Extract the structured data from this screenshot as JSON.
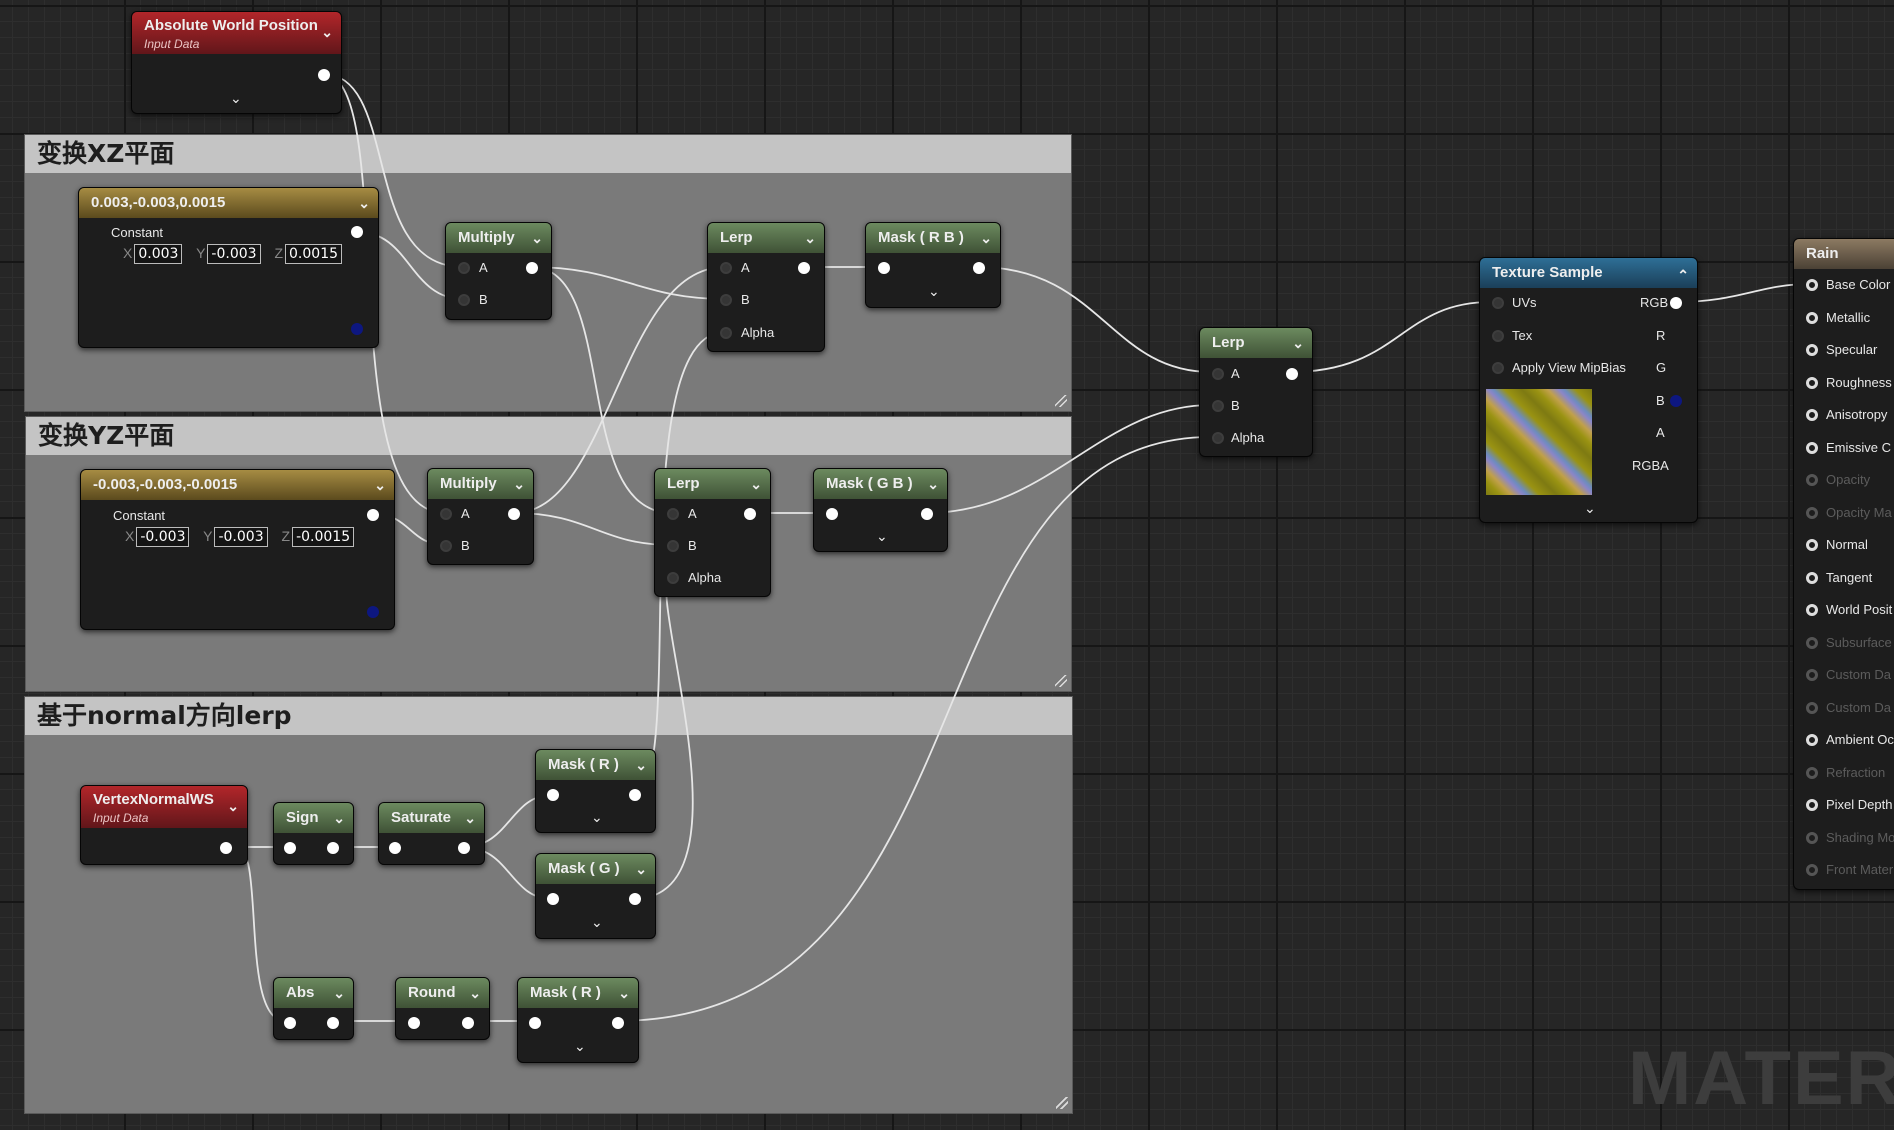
{
  "comments": {
    "xz": {
      "title": "变换XZ平面"
    },
    "yz": {
      "title": "变换YZ平面"
    },
    "normal": {
      "title": "基于normal方向lerp"
    }
  },
  "nodes": {
    "absolute_world_position": {
      "title": "Absolute World Position",
      "subtitle": "Input Data"
    },
    "const_xz": {
      "title": "0.003,-0.003,0.0015",
      "label": "Constant",
      "x_label": "X",
      "x": "0.003",
      "y_label": "Y",
      "y": "-0.003",
      "z_label": "Z",
      "z": "0.0015"
    },
    "multiply_xz": {
      "title": "Multiply",
      "a": "A",
      "b": "B"
    },
    "lerp_xz": {
      "title": "Lerp",
      "a": "A",
      "b": "B",
      "alpha": "Alpha"
    },
    "mask_rb": {
      "title": "Mask ( R B )"
    },
    "const_yz": {
      "title": "-0.003,-0.003,-0.0015",
      "label": "Constant",
      "x_label": "X",
      "x": "-0.003",
      "y_label": "Y",
      "y": "-0.003",
      "z_label": "Z",
      "z": "-0.0015"
    },
    "multiply_yz": {
      "title": "Multiply",
      "a": "A",
      "b": "B"
    },
    "lerp_yz": {
      "title": "Lerp",
      "a": "A",
      "b": "B",
      "alpha": "Alpha"
    },
    "mask_gb": {
      "title": "Mask ( G B )"
    },
    "vertex_normal": {
      "title": "VertexNormalWS",
      "subtitle": "Input Data"
    },
    "sign": {
      "title": "Sign"
    },
    "saturate": {
      "title": "Saturate"
    },
    "mask_r_top": {
      "title": "Mask ( R )"
    },
    "mask_g": {
      "title": "Mask ( G )"
    },
    "abs": {
      "title": "Abs"
    },
    "round": {
      "title": "Round"
    },
    "mask_r_bottom": {
      "title": "Mask ( R )"
    },
    "lerp_main": {
      "title": "Lerp",
      "a": "A",
      "b": "B",
      "alpha": "Alpha"
    },
    "texture_sample": {
      "title": "Texture Sample",
      "uvs": "UVs",
      "tex": "Tex",
      "mip": "Apply View MipBias",
      "rgb": "RGB",
      "r": "R",
      "g": "G",
      "b": "B",
      "a": "A",
      "rgba": "RGBA"
    },
    "rain": {
      "title": "Rain",
      "pins": [
        "Base Color",
        "Metallic",
        "Specular",
        "Roughness",
        "Anisotropy",
        "Emissive C",
        "Opacity",
        "Opacity Ma",
        "Normal",
        "Tangent",
        "World Posit",
        "Subsurface",
        "Custom Da",
        "Custom Da",
        "Ambient Oc",
        "Refraction",
        "Pixel Depth",
        "Shading Mo",
        "Front Mater"
      ],
      "enabled": [
        true,
        true,
        true,
        true,
        true,
        true,
        false,
        false,
        true,
        true,
        true,
        false,
        false,
        false,
        true,
        false,
        true,
        false,
        false
      ]
    }
  },
  "icons": {
    "dropdown": "chevron-down-icon",
    "collapse": "chevron-up-icon",
    "resize": "resize-grip-icon"
  },
  "colors": {
    "comment_header": "#c4c4c4",
    "comment_body": "#7a7a7a",
    "node_body": "#1d1d1d",
    "math_header": "#5c7a50",
    "constant_header": "#9a8339",
    "input_header": "#a82227",
    "texture_header": "#2e6f96",
    "result_header": "#8c7a62",
    "wire": "#e6e6e6"
  },
  "watermark": "MATERIA"
}
